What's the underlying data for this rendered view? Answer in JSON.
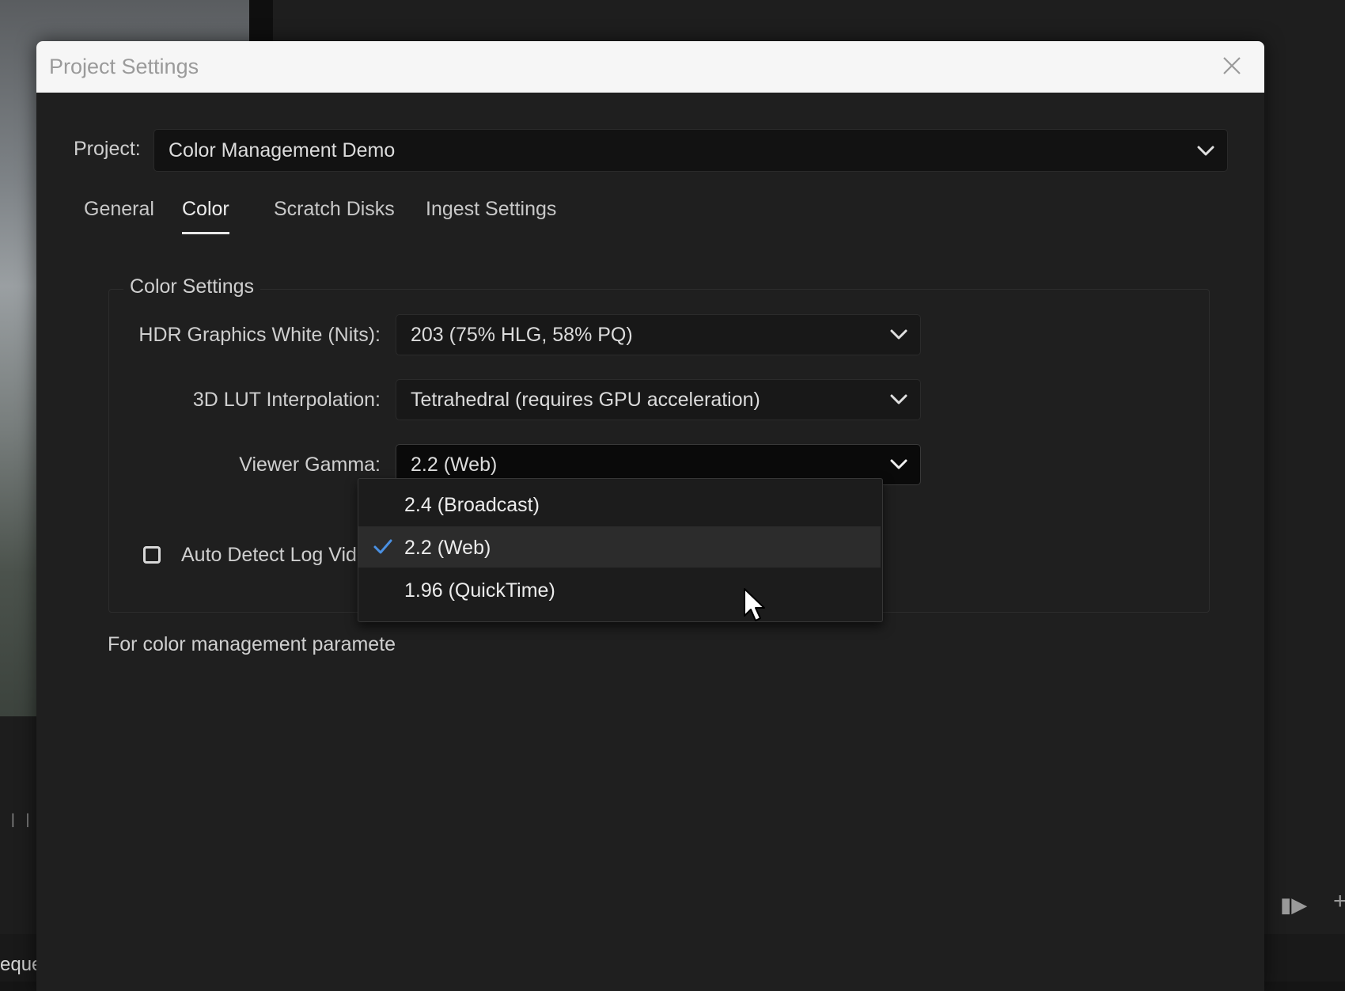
{
  "background": {
    "sequence_fragment": "eque"
  },
  "dialog": {
    "title": "Project Settings",
    "project_label": "Project:",
    "project_value": "Color Management Demo",
    "tabs": [
      {
        "label": "General",
        "active": false
      },
      {
        "label": "Color",
        "active": true
      },
      {
        "label": "Scratch Disks",
        "active": false
      },
      {
        "label": "Ingest Settings",
        "active": false
      }
    ],
    "color_settings": {
      "legend": "Color Settings",
      "hdr_label": "HDR Graphics White (Nits):",
      "hdr_value": "203 (75% HLG, 58% PQ)",
      "lut_label": "3D LUT Interpolation:",
      "lut_value": "Tetrahedral (requires GPU acceleration)",
      "gamma_label": "Viewer Gamma:",
      "gamma_value": "2.2 (Web)",
      "auto_detect_label": "Auto Detect Log Video C",
      "auto_detect_checked": false
    },
    "footer_note": "For color management paramete"
  },
  "gamma_menu": {
    "items": [
      {
        "label": "2.4 (Broadcast)",
        "selected": false
      },
      {
        "label": "2.2 (Web)",
        "selected": true
      },
      {
        "label": "1.96 (QuickTime)",
        "selected": false
      }
    ]
  },
  "colors": {
    "accent_check": "#4a90e2",
    "dialog_bg": "#1f1f1f",
    "titlebar_bg": "#f6f6f6"
  }
}
